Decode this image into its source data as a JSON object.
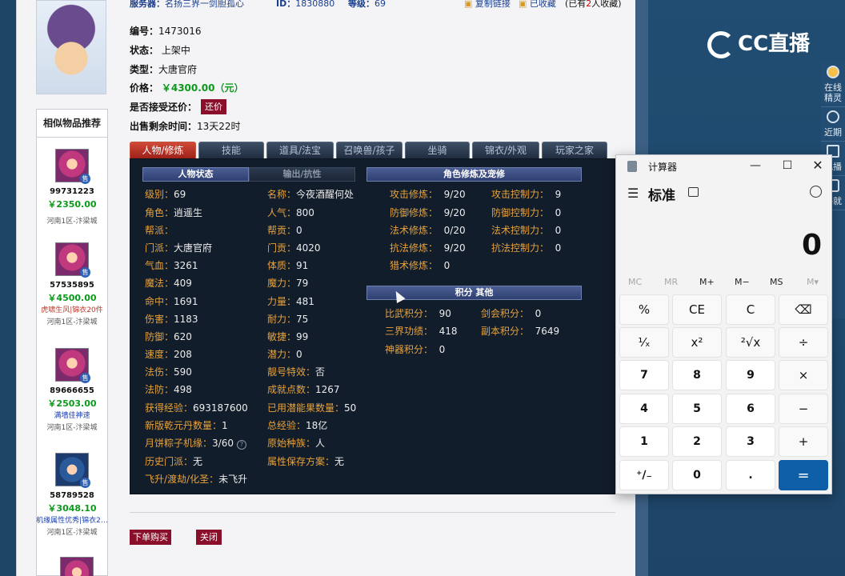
{
  "top_bar": {
    "server_label": "服务器：",
    "server_value": "名扬三界一剑胆孤心",
    "id_label": "ID：",
    "id_value": "1830880",
    "level_label": "等级：",
    "level_value": "69",
    "copy_link": "复制链接",
    "favorited": "已收藏",
    "fav_count_prefix": "(已有",
    "fav_count": "2",
    "fav_count_suffix": "人收藏)"
  },
  "item": {
    "serial_label": "编号：",
    "serial_value": "1473016",
    "status_label": "状态：",
    "status_value": "上架中",
    "type_label": "类型：",
    "type_value": "大唐官府",
    "price_label": "价格：",
    "price_value": "￥4300.00（元）",
    "counter_label": "是否接受还价：",
    "counter_button": "还价",
    "remaining_label": "出售剩余时间：",
    "remaining_value": "13天22时"
  },
  "similar": {
    "title": "相似物品推荐",
    "items": [
      {
        "id": "99731223",
        "price": "￥2350.00",
        "extra": "",
        "server": "河南1区-汴梁城",
        "tag": "售"
      },
      {
        "id": "57535895",
        "price": "￥4500.00",
        "extra": "虎啸生风|锦衣20件",
        "server": "河南1区-汴梁城",
        "tag": "售"
      },
      {
        "id": "89666655",
        "price": "￥2503.00",
        "extra": "满墙佳神速",
        "server": "河南1区-汴梁城",
        "tag": "售"
      },
      {
        "id": "58789528",
        "price": "￥3048.10",
        "extra": "机缘属性优秀|锦衣2…",
        "server": "河南1区-汴梁城",
        "tag": "售"
      }
    ]
  },
  "tabs": [
    "人物/修炼",
    "技能",
    "道具/法宝",
    "召唤兽/孩子",
    "坐骑",
    "锦衣/外观",
    "玩家之家"
  ],
  "panel": {
    "hdr_char_status": "人物状态",
    "hdr_output": "输出/抗性",
    "hdr_cultivation": "角色修炼及宠修",
    "hdr_points": "积分 其他",
    "col1": [
      {
        "k": "级别：",
        "v": "69"
      },
      {
        "k": "角色：",
        "v": "逍遥生"
      },
      {
        "k": "帮派：",
        "v": ""
      },
      {
        "k": "门派：",
        "v": "大唐官府"
      },
      {
        "k": "气血：",
        "v": "3261"
      },
      {
        "k": "魔法：",
        "v": "409"
      },
      {
        "k": "命中：",
        "v": "1691"
      },
      {
        "k": "伤害：",
        "v": "1183"
      },
      {
        "k": "防御：",
        "v": "620"
      },
      {
        "k": "速度：",
        "v": "208"
      },
      {
        "k": "法伤：",
        "v": "590"
      },
      {
        "k": "法防：",
        "v": "498"
      },
      {
        "k": "获得经验：",
        "v": "693187600"
      },
      {
        "k": "新版乾元丹数量：",
        "v": "1"
      },
      {
        "k": "月饼粽子机缘：",
        "v": "3/60"
      },
      {
        "k": "历史门派：",
        "v": "无"
      },
      {
        "k": "飞升/渡劫/化圣：",
        "v": "未飞升"
      }
    ],
    "col2": [
      {
        "k": "名称：",
        "v": "今夜酒醒何处"
      },
      {
        "k": "人气：",
        "v": "800"
      },
      {
        "k": "帮贡：",
        "v": "0"
      },
      {
        "k": "门贡：",
        "v": "4020"
      },
      {
        "k": "体质：",
        "v": "91"
      },
      {
        "k": "魔力：",
        "v": "79"
      },
      {
        "k": "力量：",
        "v": "481"
      },
      {
        "k": "耐力：",
        "v": "75"
      },
      {
        "k": "敏捷：",
        "v": "99"
      },
      {
        "k": "潜力：",
        "v": "0"
      },
      {
        "k": "靓号特效：",
        "v": "否"
      },
      {
        "k": "成就点数：",
        "v": "1267"
      },
      {
        "k": "已用潜能果数量：",
        "v": "50"
      },
      {
        "k": "总经验：",
        "v": "18亿"
      },
      {
        "k": "原始种族：",
        "v": "人"
      },
      {
        "k": "属性保存方案：",
        "v": "无"
      }
    ],
    "cult_left": [
      {
        "k": "攻击修炼：",
        "v": "9/20"
      },
      {
        "k": "防御修炼：",
        "v": "9/20"
      },
      {
        "k": "法术修炼：",
        "v": "0/20"
      },
      {
        "k": "抗法修炼：",
        "v": "9/20"
      },
      {
        "k": "猎术修炼：",
        "v": "0"
      }
    ],
    "cult_right": [
      {
        "k": "攻击控制力：",
        "v": "9"
      },
      {
        "k": "防御控制力：",
        "v": "0"
      },
      {
        "k": "法术控制力：",
        "v": "0"
      },
      {
        "k": "抗法控制力：",
        "v": "0"
      }
    ],
    "points_left": [
      {
        "k": "比武积分：",
        "v": "90"
      },
      {
        "k": "三界功绩：",
        "v": "418"
      },
      {
        "k": "神器积分：",
        "v": "0"
      }
    ],
    "points_right": [
      {
        "k": "剑会积分：",
        "v": "0"
      },
      {
        "k": "副本积分：",
        "v": "7649"
      }
    ]
  },
  "buttons": {
    "buy": "下单购买",
    "close": "关闭"
  },
  "overlay": {
    "logo_text": "CC直播",
    "tools": [
      {
        "icon": "avatar-icon",
        "label": "在线精灵"
      },
      {
        "icon": "clock-icon",
        "label": "近期"
      },
      {
        "icon": "pen-icon",
        "label": "观播"
      },
      {
        "icon": "gift-icon",
        "label": "玛就"
      }
    ]
  },
  "calculator": {
    "title": "计算器",
    "mode": "标准",
    "display": "0",
    "memory": [
      "MC",
      "MR",
      "M+",
      "M−",
      "MS",
      "M▾"
    ],
    "keys": [
      [
        "%",
        "CE",
        "C",
        "⌫"
      ],
      [
        "¹⁄ₓ",
        "x²",
        "²√x",
        "÷"
      ],
      [
        "7",
        "8",
        "9",
        "×"
      ],
      [
        "4",
        "5",
        "6",
        "−"
      ],
      [
        "1",
        "2",
        "3",
        "+"
      ],
      [
        "⁺∕₋",
        "0",
        ".",
        "="
      ]
    ],
    "accent": "#0e5ea8"
  }
}
